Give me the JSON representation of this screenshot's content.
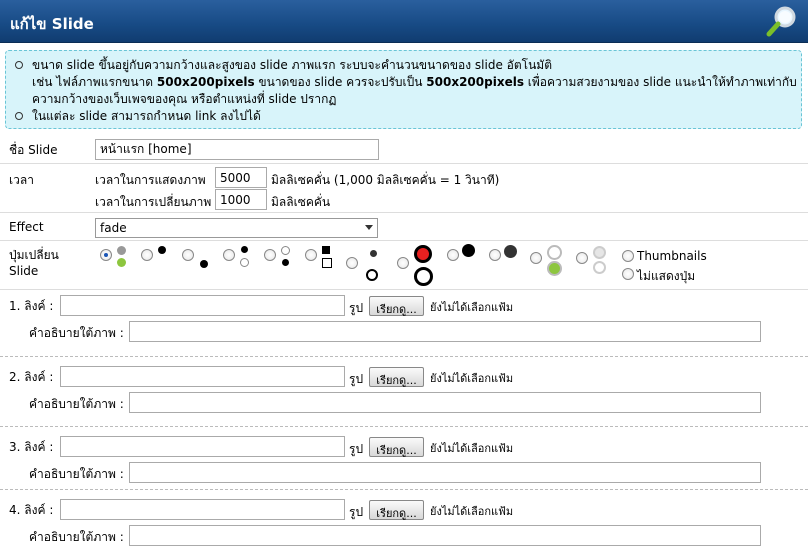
{
  "header": {
    "title": "แก้ไข Slide",
    "icon": "magnifier-icon"
  },
  "info": {
    "line1": "ขนาด slide ขึ้นอยู่กับความกว้างและสูงของ slide ภาพแรก ระบบจะคำนวนขนาดของ slide อัตโนมัติ",
    "line2a": "เช่น ไฟล์ภาพแรกขนาด ",
    "line2b": "500x200pixels",
    "line2c": " ขนาดของ slide ควรจะปรับเป็น ",
    "line2d": "500x200pixels",
    "line2e": " เพื่อความสวยงามของ slide แนะนำให้ทำภาพเท่ากับ",
    "line3": "ความกว้างของเว็บเพจของคุณ หรือตำแหน่งที่ slide ปรากฏ",
    "line4": "ในแต่ละ slide สามารถกำหนด link ลงไปได้"
  },
  "form": {
    "name_label": "ชื่อ Slide",
    "name_value": "หน้าแรก [home]",
    "time_label": "เวลา",
    "show_label": "เวลาในการแสดงภาพ",
    "show_value": "5000",
    "show_unit": "มิลลิเซคคั่น (1,000 มิลลิเซคคั่น = 1 วินาที)",
    "change_label": "เวลาในการเปลี่ยนภาพ",
    "change_value": "1000",
    "change_unit": "มิลลิเซคคั่น",
    "effect_label": "Effect",
    "effect_value": "fade",
    "buttons_label1": "ปุ่มเปลี่ยน",
    "buttons_label2": "Slide",
    "opt_thumbnails": "Thumbnails",
    "opt_hide": "ไม่แสดงปุ่ม"
  },
  "links": [
    {
      "label": "1. ลิงค์ :",
      "img_label": "รูป",
      "browse": "เรียกดู...",
      "status": "ยังไม่ได้เลือกแฟ้ม",
      "desc_label": "คำอธิบายใต้ภาพ :"
    },
    {
      "label": "2. ลิงค์ :",
      "img_label": "รูป",
      "browse": "เรียกดู...",
      "status": "ยังไม่ได้เลือกแฟ้ม",
      "desc_label": "คำอธิบายใต้ภาพ :"
    },
    {
      "label": "3. ลิงค์ :",
      "img_label": "รูป",
      "browse": "เรียกดู...",
      "status": "ยังไม่ได้เลือกแฟ้ม",
      "desc_label": "คำอธิบายใต้ภาพ :"
    },
    {
      "label": "4. ลิงค์ :",
      "img_label": "รูป",
      "browse": "เรียกดู...",
      "status": "ยังไม่ได้เลือกแฟ้ม",
      "desc_label": "คำอธิบายใต้ภาพ :"
    }
  ]
}
